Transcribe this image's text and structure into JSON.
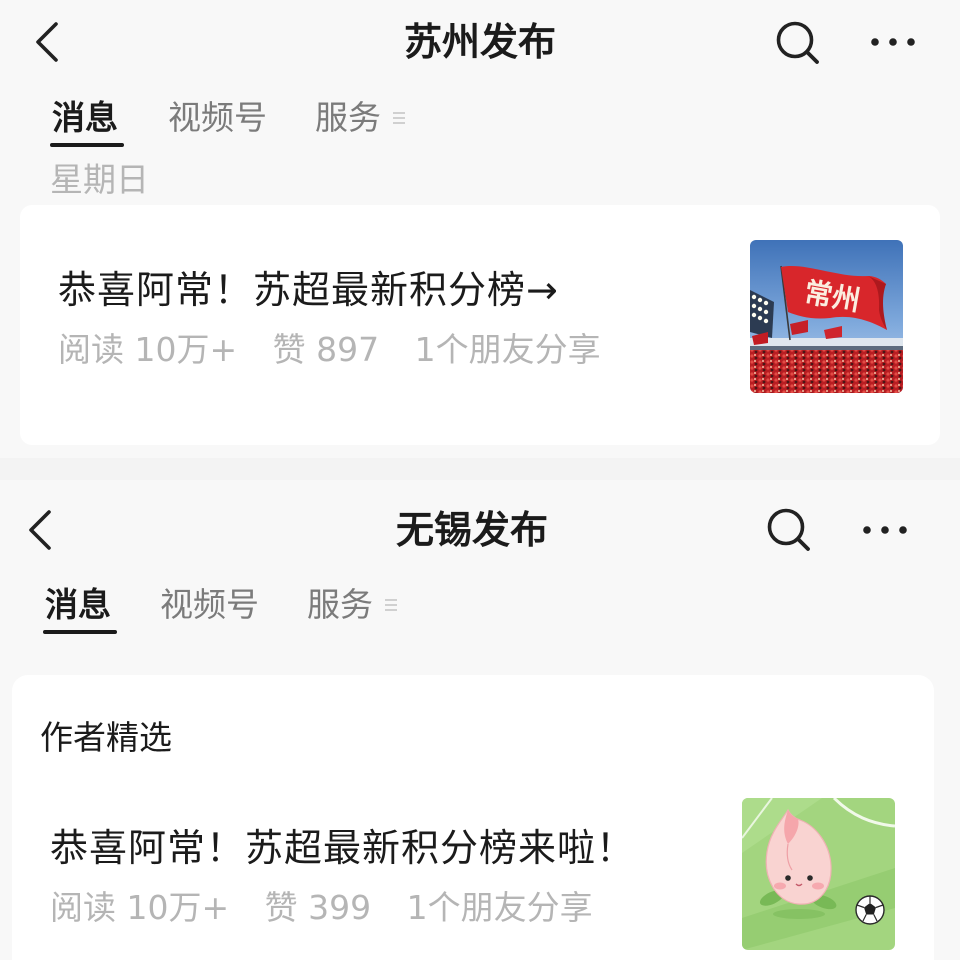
{
  "colors": {
    "text_primary": "#1b1b1b",
    "tab_inactive": "#7b7b7b",
    "text_muted": "#b5b5b5",
    "page_background": "#f3f3f3",
    "screen_background": "#f8f8f8",
    "card_background": "#ffffff"
  },
  "screens": [
    {
      "header": {
        "back_icon": "chevron-left-icon",
        "title": "苏州发布",
        "search_icon": "search-icon",
        "more_icon": "more-dots-icon"
      },
      "tabs": [
        {
          "label": "消息",
          "active": true
        },
        {
          "label": "视频号",
          "active": false
        },
        {
          "label": "服务",
          "active": false,
          "icon": "menu-icon"
        }
      ],
      "date_label": "星期日",
      "article": {
        "title": "恭喜阿常！苏超最新积分榜→",
        "reads": "阅读 10万+",
        "likes": "赞 897",
        "friends_shared": "1个朋友分享",
        "thumbnail": {
          "flag_text": "常州"
        }
      }
    },
    {
      "header": {
        "back_icon": "chevron-left-icon",
        "title": "无锡发布",
        "search_icon": "search-icon",
        "more_icon": "more-dots-icon"
      },
      "tabs": [
        {
          "label": "消息",
          "active": true
        },
        {
          "label": "视频号",
          "active": false
        },
        {
          "label": "服务",
          "active": false,
          "icon": "menu-icon"
        }
      ],
      "section_label": "作者精选",
      "article": {
        "title": "恭喜阿常！苏超最新积分榜来啦！",
        "reads": "阅读 10万+",
        "likes": "赞 399",
        "friends_shared": "1个朋友分享"
      }
    }
  ]
}
